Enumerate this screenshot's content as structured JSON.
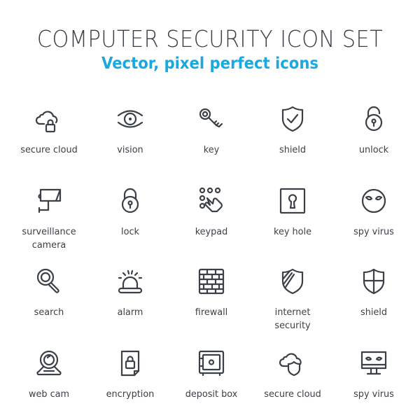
{
  "header": {
    "title": "COMPUTER SECURITY ICON SET",
    "subtitle": "Vector, pixel perfect icons"
  },
  "colors": {
    "icon": "#3b4046",
    "accent": "#1ba8e0"
  },
  "icons": [
    {
      "icon": "cloud-lock-icon",
      "label": "secure cloud"
    },
    {
      "icon": "eye-icon",
      "label": "vision"
    },
    {
      "icon": "key-icon",
      "label": "key"
    },
    {
      "icon": "shield-check-icon",
      "label": "shield"
    },
    {
      "icon": "unlock-icon",
      "label": "unlock"
    },
    {
      "icon": "surveillance-camera-icon",
      "label": "surveillance camera"
    },
    {
      "icon": "lock-icon",
      "label": "lock"
    },
    {
      "icon": "keypad-icon",
      "label": "keypad"
    },
    {
      "icon": "key-hole-icon",
      "label": "key hole"
    },
    {
      "icon": "alien-face-icon",
      "label": "spy virus"
    },
    {
      "icon": "magnifier-icon",
      "label": "search"
    },
    {
      "icon": "siren-icon",
      "label": "alarm"
    },
    {
      "icon": "brick-wall-icon",
      "label": "firewall"
    },
    {
      "icon": "shield-stripes-icon",
      "label": "internet security"
    },
    {
      "icon": "shield-cross-icon",
      "label": "shield"
    },
    {
      "icon": "webcam-icon",
      "label": "web cam"
    },
    {
      "icon": "locked-document-icon",
      "label": "encryption"
    },
    {
      "icon": "safe-icon",
      "label": "deposit box"
    },
    {
      "icon": "cloud-shield-icon",
      "label": "secure cloud"
    },
    {
      "icon": "monitor-alien-icon",
      "label": "spy virus"
    }
  ]
}
